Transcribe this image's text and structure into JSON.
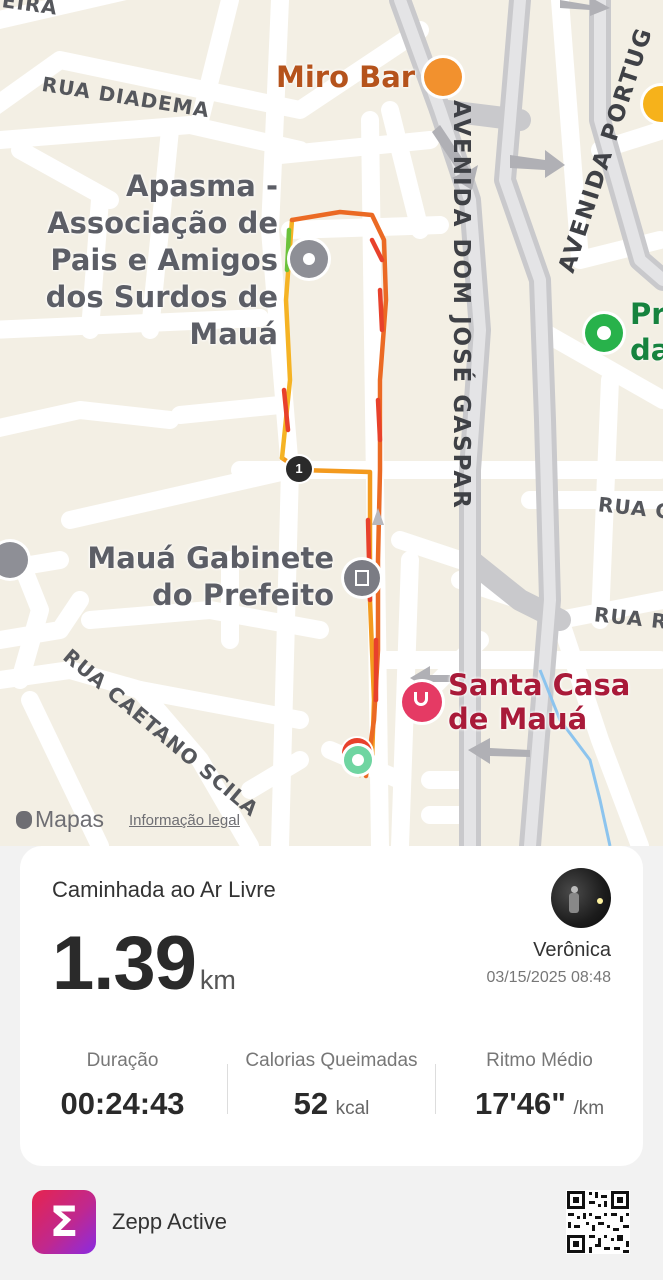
{
  "map": {
    "streets": {
      "top_left_fragment": "EIRA",
      "rua_diadema": "RUA DIADEMA",
      "avenida_dom_jose_gaspar": "AVENIDA DOM JOSÉ GASPAR",
      "avenida_portuguesa": "AVENIDA PORTUG",
      "rua_caetano_scila": "RUA CAETANO SCILA",
      "rua_right_1": "RUA C",
      "rua_right_2": "RUA R"
    },
    "pois": {
      "miro_bar": "Miro Bar",
      "apasma": [
        "Apasma -",
        "Associação de",
        "Pais e Amigos",
        "dos Surdos de",
        "Mauá"
      ],
      "gabinete": [
        "Mauá Gabinete",
        "do Prefeito"
      ],
      "santa_casa": [
        "Santa Casa",
        "de Mauá"
      ],
      "green_poi": [
        "Pr",
        "da"
      ]
    },
    "lap_marker": "1",
    "attribution": {
      "brand": "Mapas",
      "legal": "Informação legal"
    }
  },
  "activity": {
    "type": "Caminhada ao Ar Livre",
    "distance": "1.39",
    "distance_unit": "km",
    "user_name": "Verônica",
    "datetime": "03/15/2025 08:48",
    "stats": [
      {
        "label": "Duração",
        "value": "00:24:43",
        "unit": ""
      },
      {
        "label": "Calorias Queimadas",
        "value": "52",
        "unit": "kcal"
      },
      {
        "label": "Ritmo Médio",
        "value": "17'46\"",
        "unit": "/km"
      }
    ]
  },
  "footer": {
    "app_name": "Zepp Active",
    "logo_glyph": "Σ"
  },
  "colors": {
    "route_orange": "#f39a1e",
    "route_red": "#e8412c",
    "accent_gradient_start": "#e6244e",
    "accent_gradient_end": "#8a2be2",
    "poi_red": "#a91a39"
  }
}
